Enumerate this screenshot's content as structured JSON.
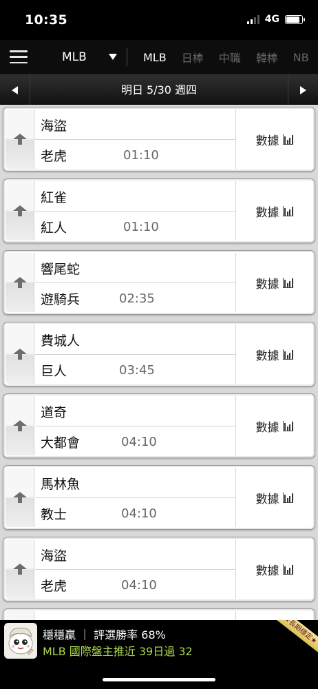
{
  "status_bar": {
    "time": "10:35",
    "network": "4G",
    "battery_level": 0.85
  },
  "nav": {
    "selected_league": "MLB",
    "tabs": [
      {
        "label": "MLB",
        "active": true
      },
      {
        "label": "日棒",
        "active": false
      },
      {
        "label": "中職",
        "active": false
      },
      {
        "label": "韓棒",
        "active": false
      },
      {
        "label": "NB",
        "active": false
      }
    ]
  },
  "date_bar": {
    "label": "明日 5/30 週四"
  },
  "games": [
    {
      "away": "海盜",
      "home": "老虎",
      "time": "01:10",
      "stats_label": "數據"
    },
    {
      "away": "紅雀",
      "home": "紅人",
      "time": "01:10",
      "stats_label": "數據"
    },
    {
      "away": "響尾蛇",
      "home": "遊騎兵",
      "time": "02:35",
      "stats_label": "數據"
    },
    {
      "away": "費城人",
      "home": "巨人",
      "time": "03:45",
      "stats_label": "數據"
    },
    {
      "away": "道奇",
      "home": "大都會",
      "time": "04:10",
      "stats_label": "數據"
    },
    {
      "away": "馬林魚",
      "home": "教士",
      "time": "04:10",
      "stats_label": "數據"
    },
    {
      "away": "海盜",
      "home": "老虎",
      "time": "04:10",
      "stats_label": "數據"
    }
  ],
  "banner": {
    "line1": "穩穩贏 ｜ 評選勝率 68%",
    "line2": "MLB 國際盤主推近 39日過 32",
    "badge": "★長期穩定★",
    "accent_color": "#a9d84a"
  }
}
